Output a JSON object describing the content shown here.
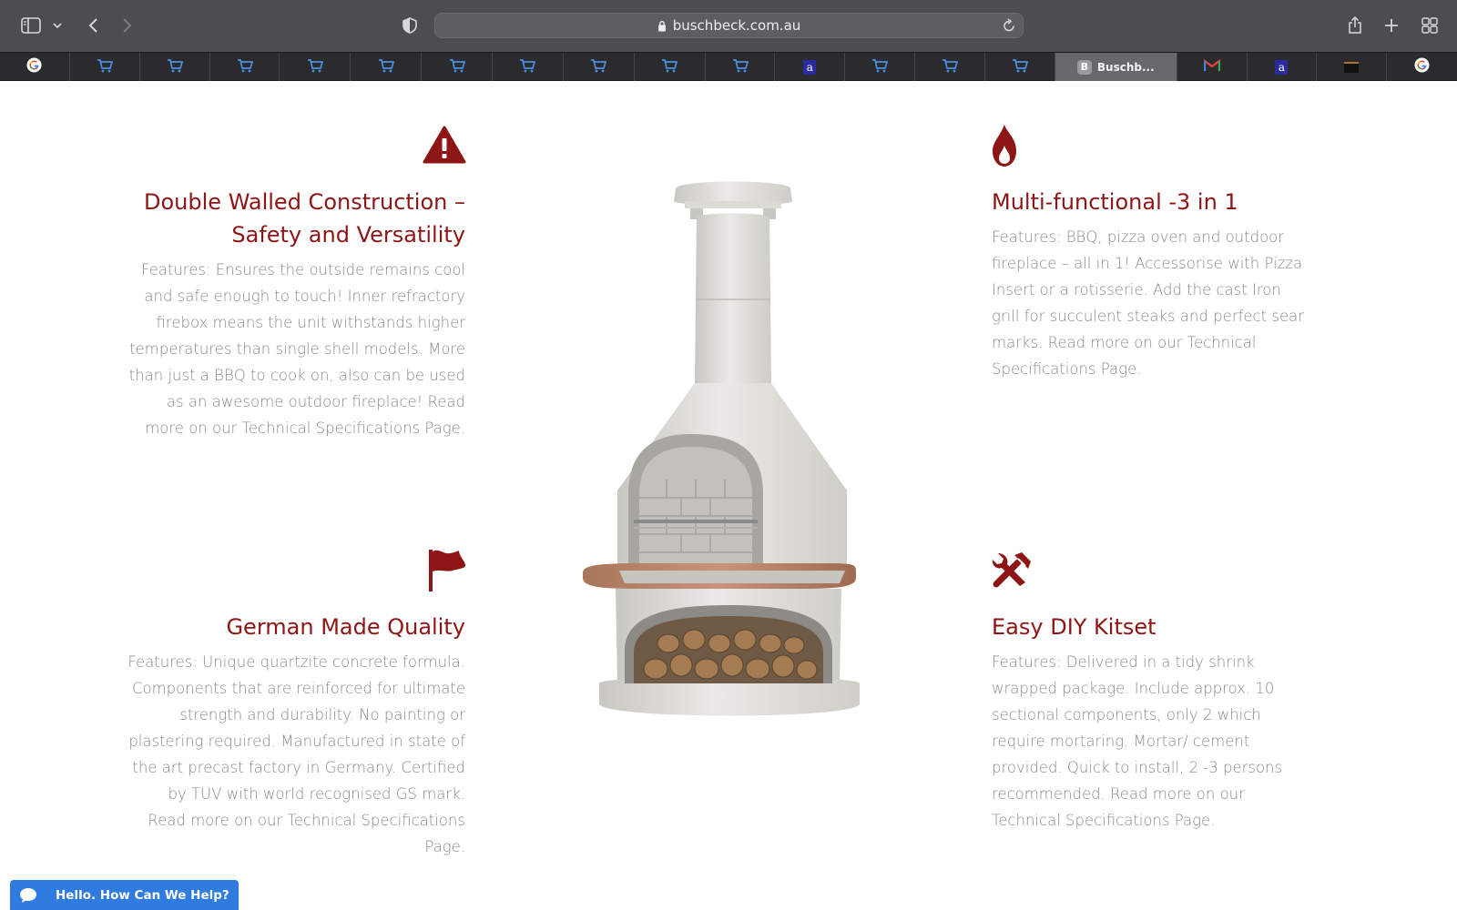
{
  "browser": {
    "url": "buschbeck.com.au",
    "active_tab_label": "Buschb...",
    "active_tab_badge": "B",
    "amazon_letter": "a"
  },
  "features": {
    "top_left": {
      "title_line1": "Double Walled Construction –",
      "title_line2": "Safety and Versatility",
      "body": "Features: Ensures the outside remains cool and safe enough to touch! Inner refractory firebox means the unit withstands higher temperatures than single shell models. More than just a BBQ to cook on, also can be used as an awesome outdoor fireplace! Read more on our Technical Specifications Page.",
      "icon": "warning-icon"
    },
    "top_right": {
      "title": "Multi-functional -3 in 1",
      "body": "Features: BBQ, pizza oven and outdoor fireplace – all in 1! Accessorise with Pizza Insert or a rotisserie. Add the cast Iron grill for succulent steaks and perfect sear marks. Read more on our Technical Specifications Page.",
      "icon": "flame-icon"
    },
    "bottom_left": {
      "title": "German Made Quality",
      "body": "Features: Unique quartzite concrete formula. Components that are reinforced for ultimate strength and durability. No painting or plastering required. Manufactured in state of the art precast factory in Germany. Certified by TUV with world recognised GS mark. Read more on our Technical Specifications Page.",
      "icon": "flag-icon"
    },
    "bottom_right": {
      "title": "Easy DIY Kitset",
      "body": "Features: Delivered in a tidy shrink wrapped package. Include approx. 10 sectional components, only 2 which require mortaring. Mortar/ cement provided. Quick to install, 2 -3 persons recommended. Read more on our Technical Specifications Page.",
      "icon": "tools-icon"
    }
  },
  "chat": {
    "label": "Hello. How Can We Help?"
  },
  "colors": {
    "accent": "#8e1515",
    "body_text": "#8a8a8a",
    "chat_blue": "#2f7be0"
  }
}
